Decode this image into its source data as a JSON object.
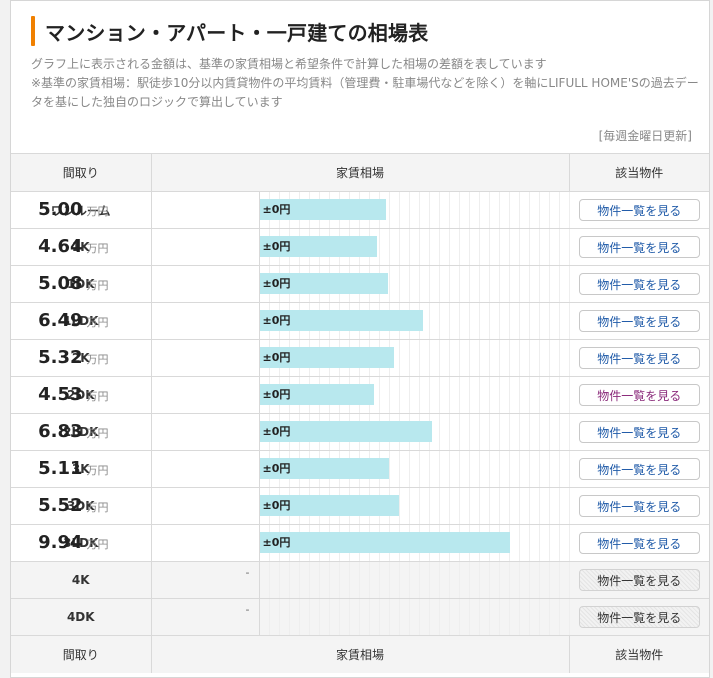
{
  "header": {
    "title": "マンション・アパート・一戸建ての相場表",
    "desc1": "グラフ上に表示される金額は、基準の家賃相場と希望条件で計算した相場の差額を表しています",
    "desc2": "※基準の家賃相場：駅徒歩10分以内賃貸物件の平均賃料（管理費・駐車場代などを除く）を軸にLIFULL HOME'Sの過去データを基にした独自のロジックで算出しています",
    "updated": "[毎週金曜日更新]"
  },
  "table": {
    "col_layout": "間取り",
    "col_price": "家賃相場",
    "col_action": "該当物件",
    "unit": "万円",
    "diff_label": "±0円",
    "button_label": "物件一覧を見る",
    "na_mark": "-",
    "rows": [
      {
        "layout": "ワンルーム",
        "price": "5.00",
        "value": 5.0,
        "available": true,
        "visited": false
      },
      {
        "layout": "1K",
        "price": "4.64",
        "value": 4.64,
        "available": true,
        "visited": false
      },
      {
        "layout": "1DK",
        "price": "5.08",
        "value": 5.08,
        "available": true,
        "visited": false
      },
      {
        "layout": "1LDK",
        "price": "6.49",
        "value": 6.49,
        "available": true,
        "visited": false
      },
      {
        "layout": "2K",
        "price": "5.32",
        "value": 5.32,
        "available": true,
        "visited": false
      },
      {
        "layout": "2DK",
        "price": "4.53",
        "value": 4.53,
        "available": true,
        "visited": true
      },
      {
        "layout": "2LDK",
        "price": "6.83",
        "value": 6.83,
        "available": true,
        "visited": false
      },
      {
        "layout": "3K",
        "price": "5.11",
        "value": 5.11,
        "available": true,
        "visited": false
      },
      {
        "layout": "3DK",
        "price": "5.52",
        "value": 5.52,
        "available": true,
        "visited": false
      },
      {
        "layout": "3LDK",
        "price": "9.94",
        "value": 9.94,
        "available": true,
        "visited": false
      },
      {
        "layout": "4K",
        "price": "",
        "value": null,
        "available": false,
        "visited": false
      },
      {
        "layout": "4DK",
        "price": "",
        "value": null,
        "available": false,
        "visited": false
      }
    ]
  },
  "colors": {
    "accent": "#f08000",
    "bar": "#b8e8ee",
    "link": "#1f5aa8",
    "visited_link": "#8a2a7a"
  }
}
